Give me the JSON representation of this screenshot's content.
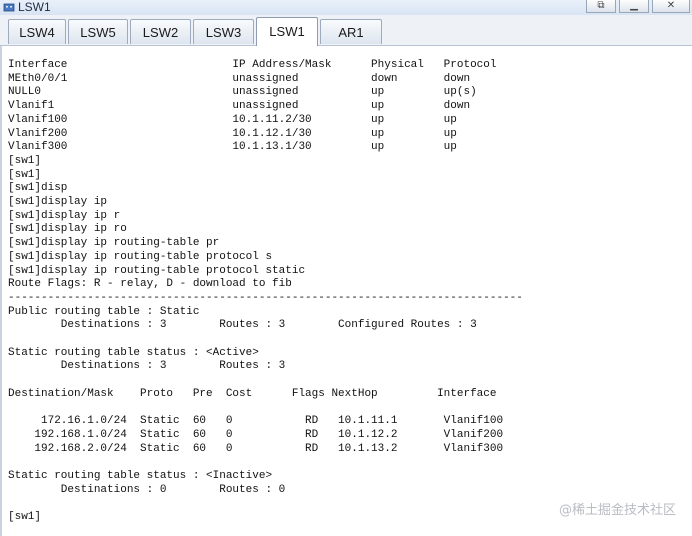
{
  "window": {
    "title": "LSW1",
    "controls": [
      "minimize",
      "maximize",
      "close"
    ]
  },
  "tabs": [
    {
      "label": "LSW4",
      "active": false
    },
    {
      "label": "LSW5",
      "active": false
    },
    {
      "label": "LSW2",
      "active": false
    },
    {
      "label": "LSW3",
      "active": false
    },
    {
      "label": "LSW1",
      "active": true
    },
    {
      "label": "AR1",
      "active": false
    }
  ],
  "terminal_lines": [
    "Interface                         IP Address/Mask      Physical   Protocol",
    "MEth0/0/1                         unassigned           down       down",
    "NULL0                             unassigned           up         up(s)",
    "Vlanif1                           unassigned           up         down",
    "Vlanif100                         10.1.11.2/30         up         up",
    "Vlanif200                         10.1.12.1/30         up         up",
    "Vlanif300                         10.1.13.1/30         up         up",
    "[sw1]",
    "[sw1]",
    "[sw1]disp",
    "[sw1]display ip",
    "[sw1]display ip r",
    "[sw1]display ip ro",
    "[sw1]display ip routing-table pr",
    "[sw1]display ip routing-table protocol s",
    "[sw1]display ip routing-table protocol static",
    "Route Flags: R - relay, D - download to fib",
    "------------------------------------------------------------------------------",
    "Public routing table : Static",
    "        Destinations : 3        Routes : 3        Configured Routes : 3",
    "",
    "Static routing table status : <Active>",
    "        Destinations : 3        Routes : 3",
    "",
    "Destination/Mask    Proto   Pre  Cost      Flags NextHop         Interface",
    "",
    "     172.16.1.0/24  Static  60   0           RD   10.1.11.1       Vlanif100",
    "    192.168.1.0/24  Static  60   0           RD   10.1.12.2       Vlanif200",
    "    192.168.2.0/24  Static  60   0           RD   10.1.13.2       Vlanif300",
    "",
    "Static routing table status : <Inactive>",
    "        Destinations : 0        Routes : 0",
    "",
    "[sw1]"
  ],
  "watermark": "@稀土掘金技术社区"
}
